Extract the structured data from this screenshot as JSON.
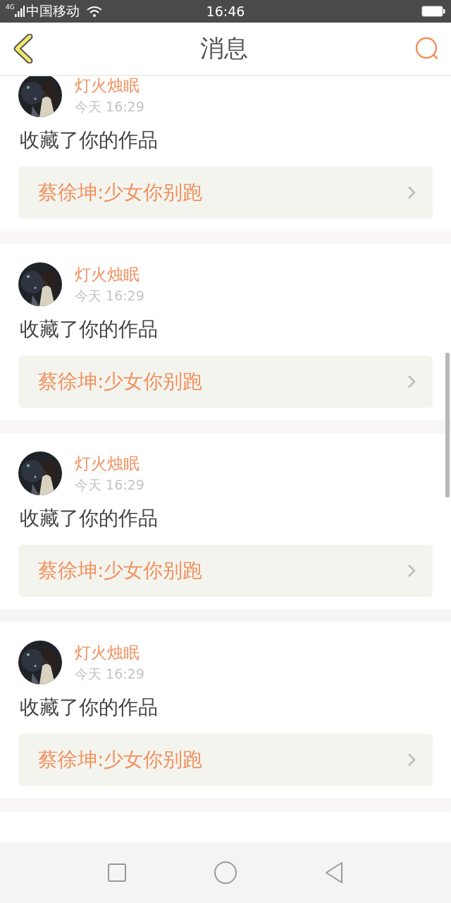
{
  "status_bar": {
    "network": "4G",
    "carrier": "中国移动",
    "time": "16:46"
  },
  "header": {
    "title": "消息"
  },
  "messages": [
    {
      "name": "灯火烛眠",
      "time": "今天 16:29",
      "action": "收藏了你的作品",
      "work": "蔡徐坤:少女你别跑"
    },
    {
      "name": "灯火烛眠",
      "time": "今天 16:29",
      "action": "收藏了你的作品",
      "work": "蔡徐坤:少女你别跑"
    },
    {
      "name": "灯火烛眠",
      "time": "今天 16:29",
      "action": "收藏了你的作品",
      "work": "蔡徐坤:少女你别跑"
    },
    {
      "name": "灯火烛眠",
      "time": "今天 16:29",
      "action": "收藏了你的作品",
      "work": "蔡徐坤:少女你别跑"
    }
  ]
}
